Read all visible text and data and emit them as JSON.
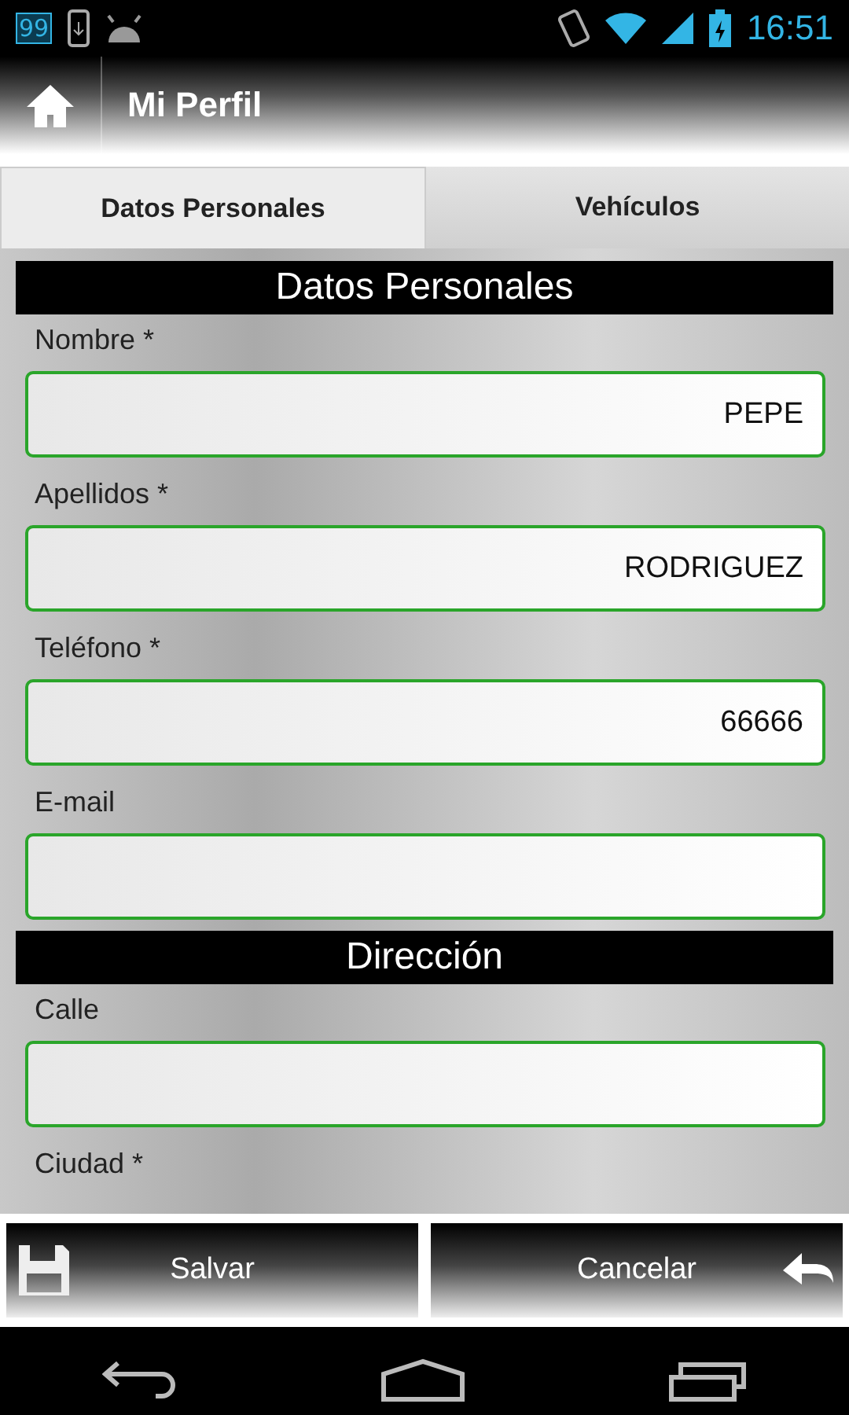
{
  "status_bar": {
    "badge": "99",
    "time": "16:51"
  },
  "action_bar": {
    "title": "Mi Perfil"
  },
  "tabs": [
    {
      "label": "Datos Personales",
      "selected": true
    },
    {
      "label": "Vehículos",
      "selected": false
    }
  ],
  "sections": [
    {
      "title": "Datos Personales",
      "fields": [
        {
          "kind": "text_field",
          "label": "Nombre *",
          "value": "PEPE"
        },
        {
          "kind": "text_field",
          "label": "Apellidos *",
          "value": "RODRIGUEZ"
        },
        {
          "kind": "text_field",
          "label": "Teléfono *",
          "value": "66666"
        },
        {
          "kind": "text_field",
          "label": "E-mail"
        }
      ]
    },
    {
      "title": "Dirección",
      "fields": [
        {
          "kind": "text_field",
          "label": "Calle"
        },
        {
          "kind": "label",
          "label": "Ciudad *"
        }
      ]
    }
  ],
  "buttons": [
    {
      "kind": "save",
      "label": "Salvar"
    },
    {
      "kind": "cancel",
      "label": "Cancelar"
    }
  ]
}
